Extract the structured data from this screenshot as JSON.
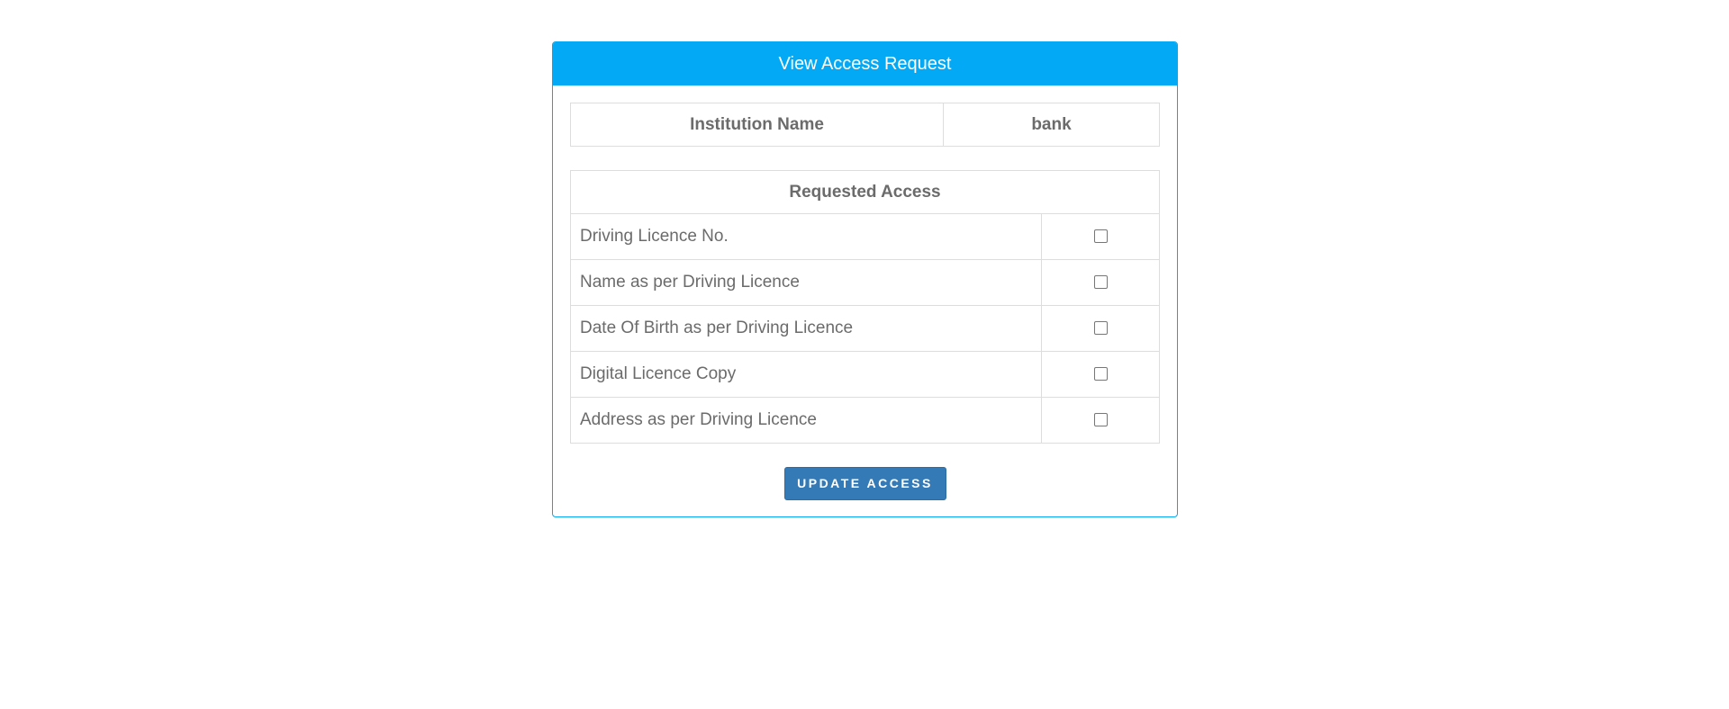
{
  "panel": {
    "title": "View Access Request"
  },
  "institution": {
    "label": "Institution Name",
    "value": "bank"
  },
  "access": {
    "header": "Requested Access",
    "items": [
      {
        "label": "Driving Licence No.",
        "checked": false
      },
      {
        "label": "Name as per Driving Licence",
        "checked": false
      },
      {
        "label": "Date Of Birth as per Driving Licence",
        "checked": false
      },
      {
        "label": "Digital Licence Copy",
        "checked": false
      },
      {
        "label": "Address as per Driving Licence",
        "checked": false
      }
    ]
  },
  "actions": {
    "update_label": "UPDATE ACCESS"
  },
  "colors": {
    "header_bg": "#03a9f4",
    "button_bg": "#337ab7"
  }
}
